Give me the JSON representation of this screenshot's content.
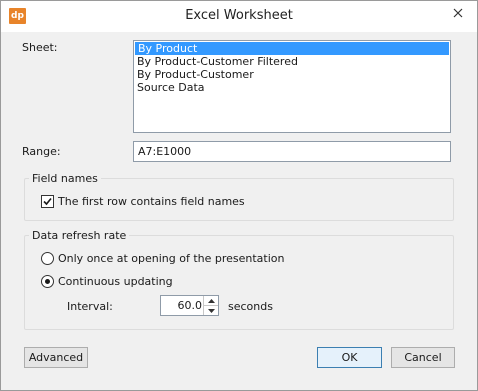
{
  "window": {
    "title": "Excel Worksheet",
    "app_icon_text": "dp"
  },
  "sheet": {
    "label": "Sheet:",
    "items": [
      "By Product",
      "By Product-Customer Filtered",
      "By Product-Customer",
      "Source Data"
    ],
    "selected": "By Product"
  },
  "range": {
    "label": "Range:",
    "value": "A7:E1000"
  },
  "field_names": {
    "group_title": "Field names",
    "checkbox_label": "The first row contains field names",
    "checked": true
  },
  "refresh": {
    "group_title": "Data refresh rate",
    "options": [
      "Only once at opening of the presentation",
      "Continuous updating"
    ],
    "selected": "Continuous updating",
    "interval_label": "Interval:",
    "interval_value": "60.0",
    "interval_unit": "seconds"
  },
  "buttons": {
    "advanced": "Advanced",
    "ok": "OK",
    "cancel": "Cancel"
  },
  "colors": {
    "selection": "#3399ff",
    "app_icon": "#e8842a",
    "dialog_bg": "#f0f0f0"
  }
}
